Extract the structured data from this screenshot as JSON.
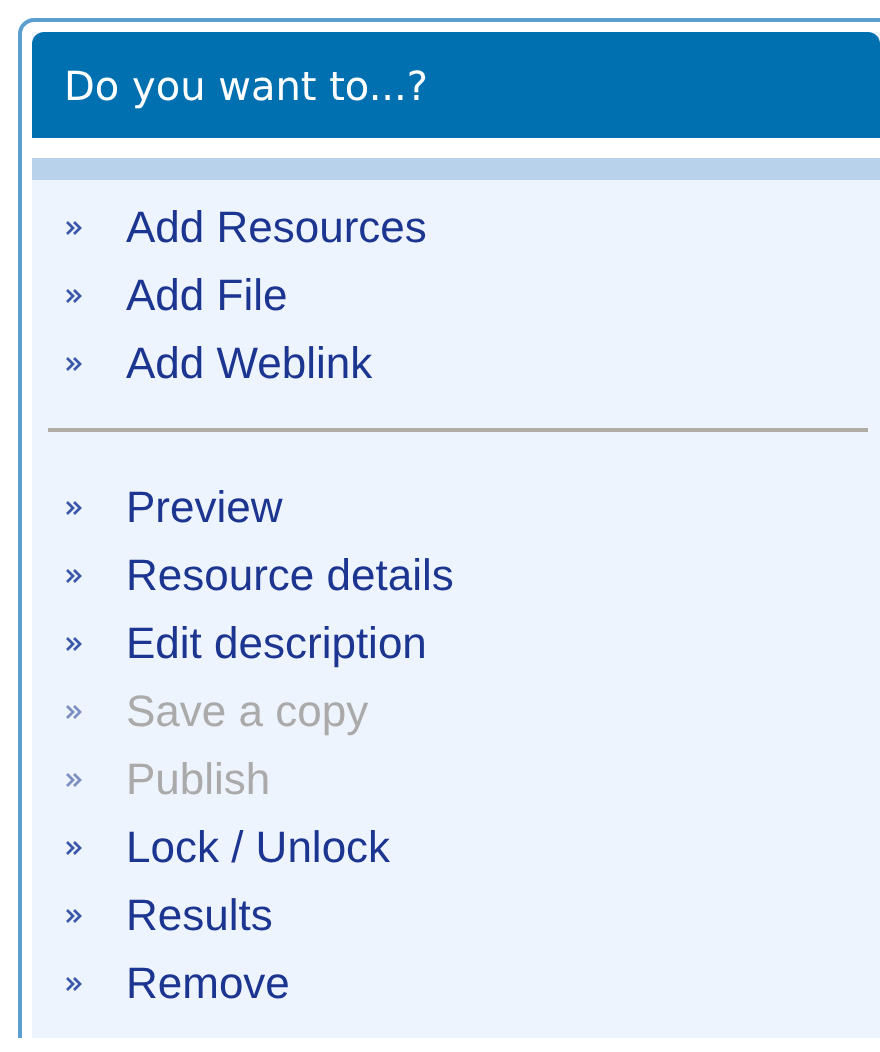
{
  "panel": {
    "title": "Do you want to...?"
  },
  "groups": [
    {
      "items": [
        {
          "label": "Add Resources",
          "disabled": false
        },
        {
          "label": "Add File",
          "disabled": false
        },
        {
          "label": "Add Weblink",
          "disabled": false
        }
      ]
    },
    {
      "items": [
        {
          "label": "Preview",
          "disabled": false
        },
        {
          "label": "Resource details",
          "disabled": false
        },
        {
          "label": "Edit description",
          "disabled": false
        },
        {
          "label": "Save a copy",
          "disabled": true
        },
        {
          "label": "Publish",
          "disabled": true
        },
        {
          "label": "Lock / Unlock",
          "disabled": false
        },
        {
          "label": "Results",
          "disabled": false
        },
        {
          "label": "Remove",
          "disabled": false
        }
      ]
    }
  ]
}
